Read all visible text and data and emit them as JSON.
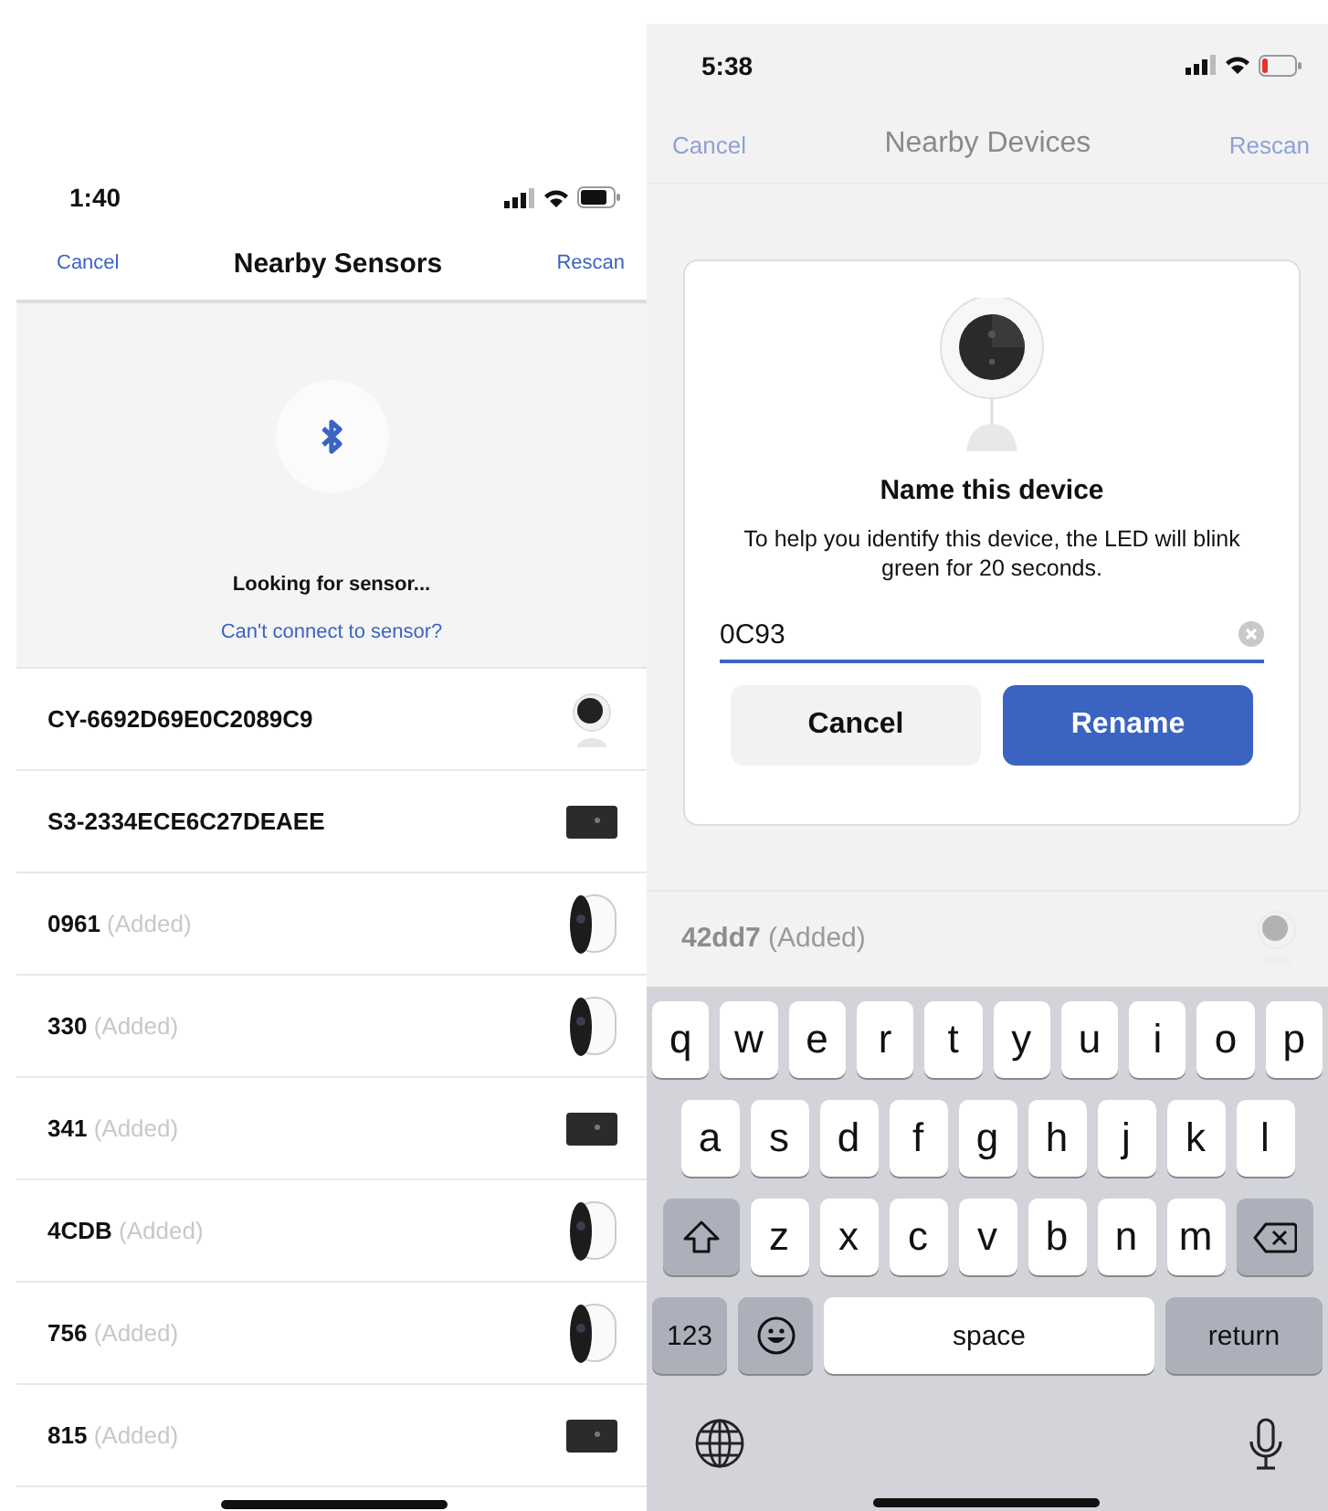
{
  "left_screen": {
    "status_bar": {
      "time": "1:40",
      "battery_low": false
    },
    "nav": {
      "cancel": "Cancel",
      "title": "Nearby Sensors",
      "rescan": "Rescan"
    },
    "scan": {
      "status": "Looking for sensor...",
      "help_link": "Can't connect to sensor?"
    },
    "sensors": [
      {
        "name": "CY-6692D69E0C2089C9",
        "kind": "indoor-camera"
      },
      {
        "name": "S3-2334ECE6C27DEAEE",
        "kind": "bar-sensor"
      },
      {
        "name": "0961",
        "tag": "(Added)",
        "kind": "outdoor-camera"
      },
      {
        "name": "330",
        "tag": "(Added)",
        "kind": "outdoor-camera"
      },
      {
        "name": "341",
        "tag": "(Added)",
        "kind": "bar-sensor"
      },
      {
        "name": "4CDB",
        "tag": "(Added)",
        "kind": "outdoor-camera"
      },
      {
        "name": "756",
        "tag": "(Added)",
        "kind": "outdoor-camera"
      },
      {
        "name": "815",
        "tag": "(Added)",
        "kind": "bar-sensor"
      }
    ]
  },
  "right_screen": {
    "status_bar": {
      "time": "5:38",
      "battery_low": true
    },
    "nav": {
      "cancel": "Cancel",
      "title": "Nearby Devices",
      "rescan": "Rescan"
    },
    "background_devices": [
      {
        "name": "42dd7",
        "tag": "(Added)",
        "kind": "indoor-camera"
      }
    ],
    "dialog": {
      "title": "Name this device",
      "message": "To help you identify this device, the LED will blink green for 20 seconds.",
      "field": {
        "value": "0C93"
      },
      "buttons": [
        {
          "label": "Cancel",
          "kind": "secondary"
        },
        {
          "label": "Rename",
          "kind": "primary"
        }
      ]
    },
    "keyboard": {
      "rows": [
        {
          "keys": [
            {
              "kind": "letter",
              "label": "q"
            },
            {
              "kind": "letter",
              "label": "w"
            },
            {
              "kind": "letter",
              "label": "e"
            },
            {
              "kind": "letter",
              "label": "r"
            },
            {
              "kind": "letter",
              "label": "t"
            },
            {
              "kind": "letter",
              "label": "y"
            },
            {
              "kind": "letter",
              "label": "u"
            },
            {
              "kind": "letter",
              "label": "i"
            },
            {
              "kind": "letter",
              "label": "o"
            },
            {
              "kind": "letter",
              "label": "p"
            }
          ]
        },
        {
          "keys": [
            {
              "kind": "letter",
              "label": "a"
            },
            {
              "kind": "letter",
              "label": "s"
            },
            {
              "kind": "letter",
              "label": "d"
            },
            {
              "kind": "letter",
              "label": "f"
            },
            {
              "kind": "letter",
              "label": "g"
            },
            {
              "kind": "letter",
              "label": "h"
            },
            {
              "kind": "letter",
              "label": "j"
            },
            {
              "kind": "letter",
              "label": "k"
            },
            {
              "kind": "letter",
              "label": "l"
            }
          ]
        },
        {
          "keys": [
            {
              "kind": "shift"
            },
            {
              "kind": "letter",
              "label": "z"
            },
            {
              "kind": "letter",
              "label": "x"
            },
            {
              "kind": "letter",
              "label": "c"
            },
            {
              "kind": "letter",
              "label": "v"
            },
            {
              "kind": "letter",
              "label": "b"
            },
            {
              "kind": "letter",
              "label": "n"
            },
            {
              "kind": "letter",
              "label": "m"
            },
            {
              "kind": "backspace"
            }
          ]
        },
        {
          "keys": [
            {
              "kind": "mode",
              "label": "123"
            },
            {
              "kind": "emoji"
            },
            {
              "kind": "space",
              "label": "space"
            },
            {
              "kind": "return",
              "label": "return"
            }
          ]
        },
        {
          "keys": [
            {
              "kind": "globe"
            },
            {
              "kind": "mic"
            }
          ]
        }
      ]
    }
  }
}
